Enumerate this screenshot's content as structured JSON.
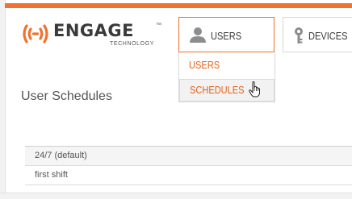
{
  "brand": {
    "name": "ENGAGE",
    "trademark": "™",
    "sub": "TECHNOLOGY",
    "logo_icon": "signal-waves-icon",
    "accent_color": "#f07230"
  },
  "nav": {
    "users": {
      "label": "USERS",
      "icon": "user-icon"
    },
    "devices": {
      "label": "DEVICES",
      "icon": "key-icon"
    }
  },
  "dropdown": {
    "items": [
      {
        "label": "USERS"
      },
      {
        "label": "SCHEDULES"
      }
    ],
    "hovered_item": "SCHEDULES",
    "text_color": "#e5621c"
  },
  "page": {
    "title": "User Schedules"
  },
  "schedules": {
    "rows": [
      {
        "name": "24/7 (default)"
      },
      {
        "name": "first shift"
      }
    ]
  }
}
